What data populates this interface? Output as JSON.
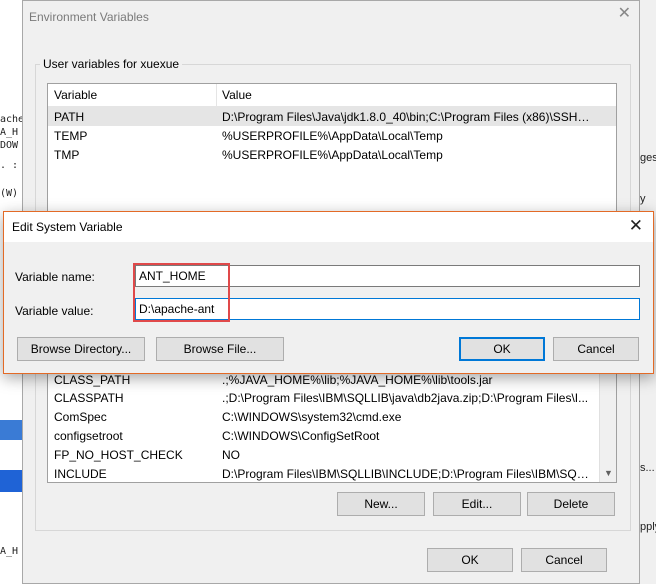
{
  "background": {
    "left_fragments": [
      "ache",
      "A_H",
      "DOW",
      ". : ;",
      "(W)",
      "A_H"
    ],
    "right_fragments": [
      "ges.",
      "y",
      "s...",
      "pply"
    ]
  },
  "env_window": {
    "title": "Environment Variables",
    "user_group_label": "User variables for xuexue",
    "user_columns": [
      "Variable",
      "Value"
    ],
    "user_vars": [
      {
        "name": "PATH",
        "value": "D:\\Program Files\\Java\\jdk1.8.0_40\\bin;C:\\Program Files (x86)\\SSH C..."
      },
      {
        "name": "TEMP",
        "value": "%USERPROFILE%\\AppData\\Local\\Temp"
      },
      {
        "name": "TMP",
        "value": "%USERPROFILE%\\AppData\\Local\\Temp"
      }
    ],
    "system_vars": [
      {
        "name": "CLASS_PATH",
        "value": ".;%JAVA_HOME%\\lib;%JAVA_HOME%\\lib\\tools.jar"
      },
      {
        "name": "CLASSPATH",
        "value": ".;D:\\Program Files\\IBM\\SQLLIB\\java\\db2java.zip;D:\\Program Files\\I..."
      },
      {
        "name": "ComSpec",
        "value": "C:\\WINDOWS\\system32\\cmd.exe"
      },
      {
        "name": "configsetroot",
        "value": "C:\\WINDOWS\\ConfigSetRoot"
      },
      {
        "name": "FP_NO_HOST_CHECK",
        "value": "NO"
      },
      {
        "name": "INCLUDE",
        "value": "D:\\Program Files\\IBM\\SQLLIB\\INCLUDE;D:\\Program Files\\IBM\\SQL..."
      }
    ],
    "buttons": {
      "new": "New...",
      "edit": "Edit...",
      "delete": "Delete",
      "ok": "OK",
      "cancel": "Cancel"
    }
  },
  "edit_dialog": {
    "title": "Edit System Variable",
    "name_label": "Variable name:",
    "value_label": "Variable value:",
    "name_value": "ANT_HOME",
    "value_value": "D:\\apache-ant",
    "buttons": {
      "browse_dir": "Browse Directory...",
      "browse_file": "Browse File...",
      "ok": "OK",
      "cancel": "Cancel"
    },
    "highlight_color": "#e0494a",
    "focus_color": "#0078d7"
  }
}
